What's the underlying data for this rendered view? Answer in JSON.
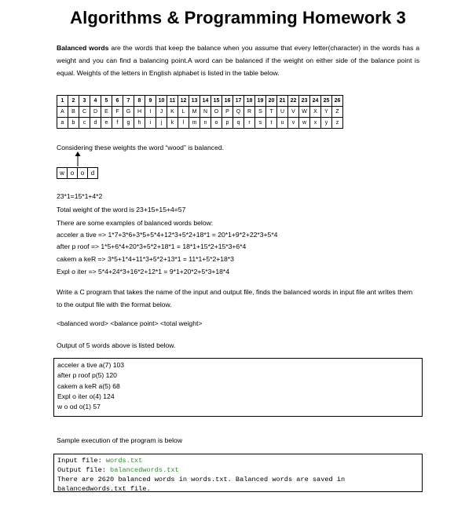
{
  "title": "Algorithms & Programming Homework 3",
  "intro": {
    "bold": "Balanced words",
    "rest": " are the words that keep the balance when you assume that every letter(character) in the words has a weight and you can find a balancing point.A word can be balanced if the weight on either side of the balance point is equal. Weights of the letters in English alphabet is listed in the table below."
  },
  "weights_table": {
    "numbers": [
      "1",
      "2",
      "3",
      "4",
      "5",
      "6",
      "7",
      "8",
      "9",
      "10",
      "11",
      "12",
      "13",
      "14",
      "15",
      "16",
      "17",
      "18",
      "19",
      "20",
      "21",
      "22",
      "23",
      "24",
      "25",
      "26"
    ],
    "upper": [
      "A",
      "B",
      "C",
      "D",
      "E",
      "F",
      "G",
      "H",
      "I",
      "J",
      "K",
      "L",
      "M",
      "N",
      "O",
      "P",
      "Q",
      "R",
      "S",
      "T",
      "U",
      "V",
      "W",
      "X",
      "Y",
      "Z"
    ],
    "lower": [
      "a",
      "b",
      "c",
      "d",
      "e",
      "f",
      "g",
      "h",
      "i",
      "j",
      "k",
      "l",
      "m",
      "n",
      "o",
      "p",
      "q",
      "r",
      "s",
      "t",
      "u",
      "v",
      "w",
      "x",
      "y",
      "z"
    ]
  },
  "considering": "Considering these weights the word “wood” is balanced.",
  "wood_letters": [
    "w",
    "o",
    "o",
    "d"
  ],
  "calc1": "23*1=15*1+4*2",
  "calc2": "Total weight of the word is 23+15+15+4=57",
  "examples_intro": "There are some examples of balanced words below:",
  "examples": [
    "acceler a tive => 1*7+3*6+3*5+5*4+12*3+5*2+18*1 = 20*1+9*2+22*3+5*4",
    "after p roof => 1*5+6*4+20*3+5*2+18*1 = 18*1+15*2+15*3+6*4",
    "cakem a keR => 3*5+1*4+11*3+5*2+13*1 = 11*1+5*2+18*3",
    "Expl o iter => 5*4+24*3+16*2+12*1 = 9*1+20*2+5*3+18*4"
  ],
  "task": "Write a C program that takes the name of the input and output file, finds the balanced words in input file ant writes them to the output file with the format below.",
  "format": "<balanced word> <balance point> <total weight>",
  "output_intro": "Output of 5 words above is listed below.",
  "output_lines": [
    "acceler a tive a(7) 103",
    "after p roof p(5) 120",
    "cakem a keR a(5) 68",
    "Expl o iter o(4)  124",
    "w o od o(1) 57"
  ],
  "sample_intro": "Sample execution of the program is below",
  "sample": {
    "input_label": "Input file: ",
    "input_value": "words.txt",
    "output_label": "Output file: ",
    "output_value": "balancedwords.txt",
    "line3": "There are 2620 balanced words in words.txt. Balanced words are saved in",
    "line4": "balancedwords.txt file."
  }
}
